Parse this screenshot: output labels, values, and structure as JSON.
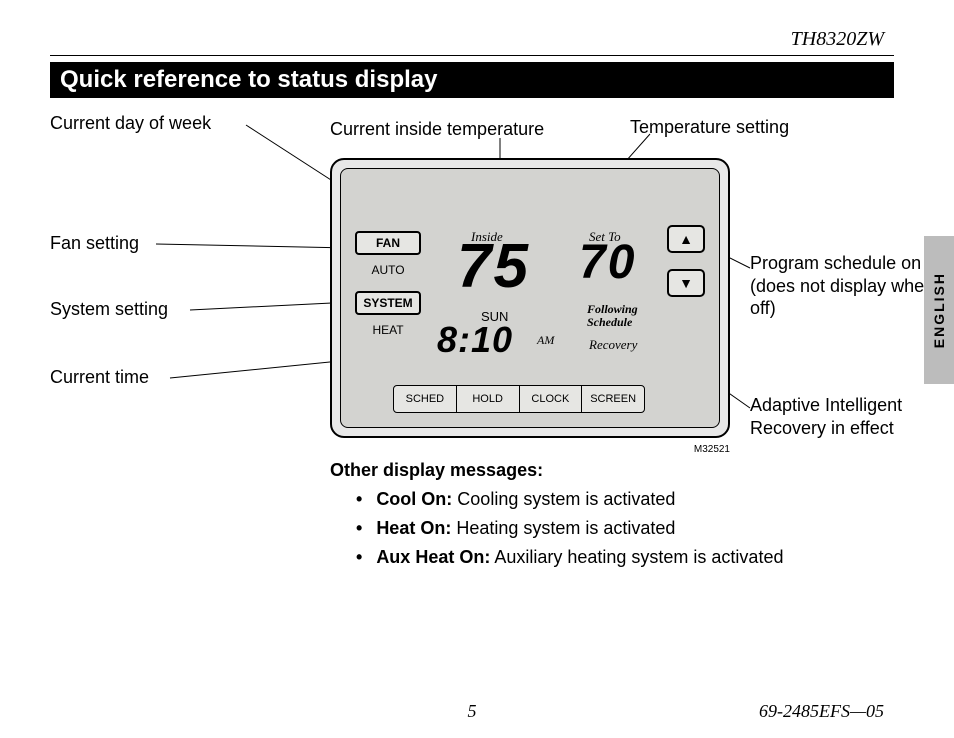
{
  "header": {
    "model": "TH8320ZW",
    "title": "Quick reference to status display"
  },
  "callouts": {
    "day": "Current day of week",
    "inside_temp": "Current inside temperature",
    "temp_setting": "Temperature setting",
    "fan": "Fan setting",
    "system": "System setting",
    "time": "Current time",
    "program": "Program schedule on (does not display when off)",
    "recovery": "Adaptive Intelligent Recovery in effect"
  },
  "thermo": {
    "fan_label": "FAN",
    "fan_value": "AUTO",
    "system_label": "SYSTEM",
    "system_value": "HEAT",
    "inside_label": "Inside",
    "inside_temp": "75",
    "setto_label": "Set To",
    "setto_temp": "70",
    "day": "SUN",
    "clock": "8:10",
    "ampm": "AM",
    "following": "Following Schedule",
    "recovery": "Recovery",
    "up_icon": "▲",
    "down_icon": "▼",
    "buttons": {
      "sched": "SCHED",
      "hold": "HOLD",
      "clock": "CLOCK",
      "screen": "SCREEN"
    },
    "fig_code": "M32521"
  },
  "other": {
    "heading": "Other display messages:",
    "items": [
      {
        "b": "Cool On:",
        "t": " Cooling system is activated"
      },
      {
        "b": "Heat On:",
        "t": " Heating system is activated"
      },
      {
        "b": "Aux Heat On:",
        "t": " Auxiliary heating system is activated"
      }
    ]
  },
  "footer": {
    "page": "5",
    "doc": "69-2485EFS—05",
    "lang": "ENGLISH"
  }
}
